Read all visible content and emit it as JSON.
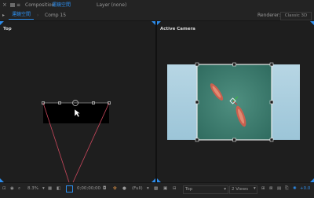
{
  "header": {
    "composition_label": "Composition",
    "composition_name": "運鏡空間",
    "layer_label": "Layer (none)",
    "active_tab": "運鏡空間",
    "second_tab": "Comp 15",
    "renderer": "Renderer:",
    "renderer_value": "Classic 3D"
  },
  "viewports": {
    "left_label": "Top",
    "right_label": "Active Camera"
  },
  "bottom_bar": {
    "zoom": "8.3%",
    "timecode": "0;00;00;00",
    "resolution": "(Full)",
    "view": "Top",
    "views": "2 Views",
    "offset": "+0.0"
  },
  "colors": {
    "accent": "#2d8ceb",
    "camera_lines": "#c8475c",
    "sea": "#3e7a6e"
  }
}
